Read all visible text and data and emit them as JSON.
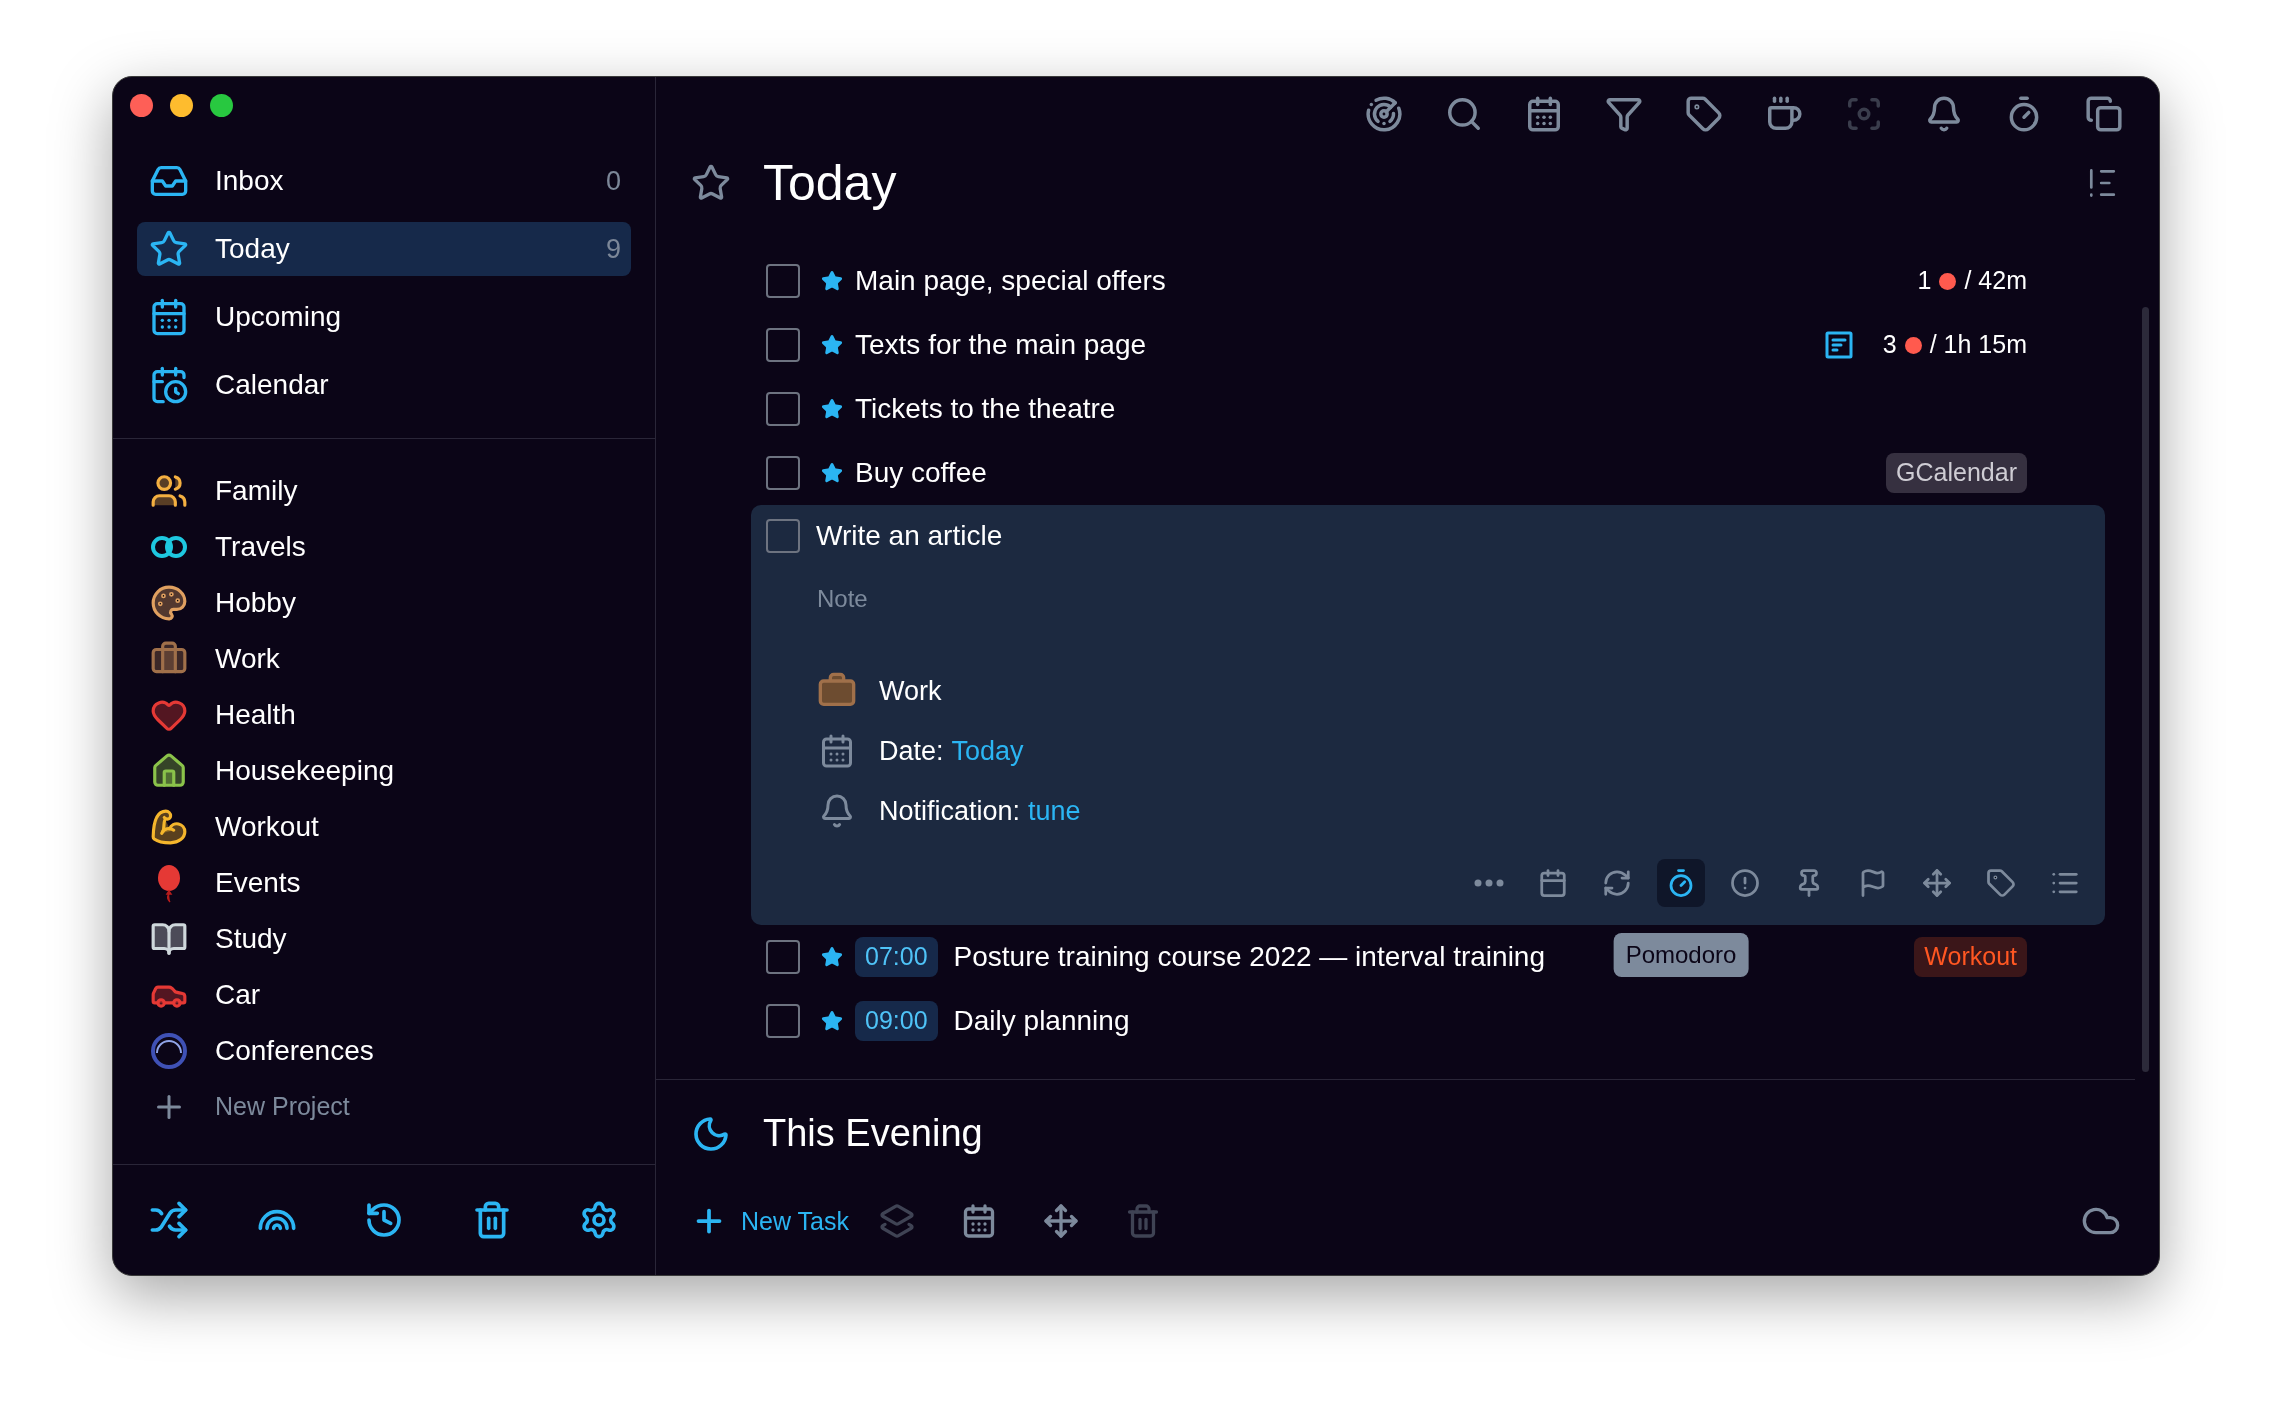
{
  "sidebar": {
    "nav": [
      {
        "label": "Inbox",
        "count": "0",
        "selected": false
      },
      {
        "label": "Today",
        "count": "9",
        "selected": true
      },
      {
        "label": "Upcoming",
        "selected": false
      },
      {
        "label": "Calendar",
        "selected": false
      }
    ],
    "projects": [
      {
        "label": "Family"
      },
      {
        "label": "Travels"
      },
      {
        "label": "Hobby"
      },
      {
        "label": "Work"
      },
      {
        "label": "Health"
      },
      {
        "label": "Housekeeping"
      },
      {
        "label": "Workout"
      },
      {
        "label": "Events"
      },
      {
        "label": "Study"
      },
      {
        "label": "Car"
      },
      {
        "label": "Conferences"
      }
    ],
    "new_project": "New Project"
  },
  "toolbar": [
    {
      "disabled": false
    },
    {
      "disabled": false
    },
    {
      "disabled": false
    },
    {
      "disabled": false
    },
    {
      "disabled": false
    },
    {
      "disabled": false
    },
    {
      "disabled": true
    },
    {
      "disabled": false
    },
    {
      "disabled": false
    },
    {
      "disabled": false
    }
  ],
  "title": "Today",
  "tasks": [
    {
      "title": "Main page, special offers",
      "checked": false,
      "starred": true,
      "pomodoros": "1",
      "duration": "/ 42m"
    },
    {
      "title": "Texts for the main page",
      "checked": false,
      "starred": true,
      "has_note": true,
      "pomodoros": "3",
      "duration": "/ 1h 15m"
    },
    {
      "title": "Tickets to the theatre",
      "checked": false,
      "starred": true
    },
    {
      "title": "Buy coffee",
      "checked": false,
      "starred": true,
      "tag": {
        "text": "GCalendar",
        "color": "#363040",
        "kind": "calendar"
      }
    },
    {
      "title": "Write an article",
      "checked": false,
      "starred": false,
      "expanded": true,
      "details": {
        "note_placeholder": "Note",
        "project": "Work",
        "date_label": "Date:",
        "date_value": "Today",
        "notification_label": "Notification:",
        "notification_value": "tune",
        "tools": [
          {
            "selected": false
          },
          {
            "selected": false
          },
          {
            "selected": false
          },
          {
            "selected": true
          },
          {
            "selected": false
          },
          {
            "selected": false
          },
          {
            "selected": false
          },
          {
            "selected": false
          },
          {
            "selected": false
          },
          {
            "selected": false
          }
        ],
        "tooltip": "Pomodoro"
      }
    },
    {
      "title": "Posture training course 2022 — interval training",
      "checked": false,
      "starred": true,
      "time": "07:00",
      "tag": {
        "text": "Workout",
        "color": "#3b1619",
        "kind": "project"
      }
    },
    {
      "title": "Daily planning",
      "checked": false,
      "starred": true,
      "time": "09:00"
    }
  ],
  "evening": {
    "title": "This Evening"
  },
  "bottom_bar": {
    "new_task": "New Task",
    "tools": [
      {
        "disabled": true
      },
      {
        "disabled": false
      },
      {
        "disabled": false
      },
      {
        "disabled": true
      }
    ]
  }
}
